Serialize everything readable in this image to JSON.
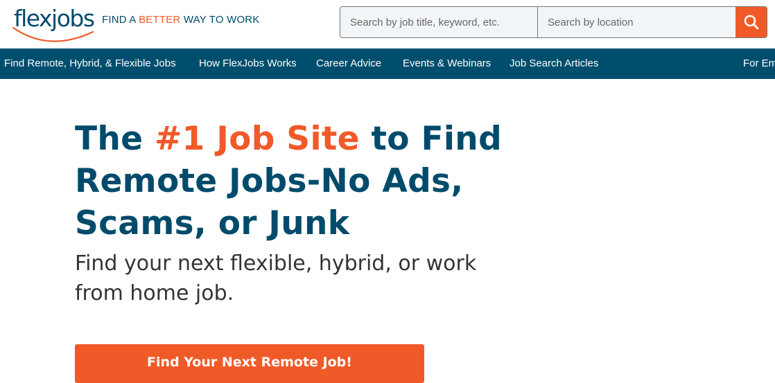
{
  "brand": {
    "logo": "flexjobs",
    "tagline_pre": "FIND A ",
    "tagline_accent": "BETTER",
    "tagline_post": " WAY TO WORK"
  },
  "search": {
    "keyword_placeholder": "Search by job title, keyword, etc.",
    "location_placeholder": "Search by location",
    "button_icon": "search-icon"
  },
  "nav": {
    "items": [
      "Find Remote, Hybrid, & Flexible Jobs",
      "How FlexJobs Works",
      "Career Advice",
      "Events & Webinars",
      "Job Search Articles",
      "For Em"
    ]
  },
  "hero": {
    "title_pre": "The ",
    "title_accent": "#1 Job Site",
    "title_post": " to Find Remote Jobs-No Ads, Scams, or Junk",
    "subtitle": "Find your next flexible, hybrid, or work from home job.",
    "cta_label": "Find Your Next Remote Job!"
  },
  "colors": {
    "brand_teal": "#004b6b",
    "nav_bg": "#004e6d",
    "accent_orange": "#f05a28"
  }
}
